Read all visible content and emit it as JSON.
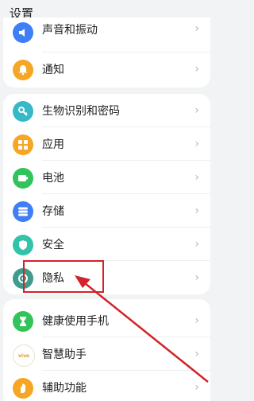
{
  "header": {
    "title": "设置"
  },
  "group1": [
    {
      "label": "声音和振动",
      "icon": "speaker-icon",
      "color": "#3f7ef5"
    },
    {
      "label": "通知",
      "icon": "bell-icon",
      "color": "#f5a623"
    }
  ],
  "group2": [
    {
      "label": "生物识别和密码",
      "icon": "key-icon",
      "color": "#35b8c8"
    },
    {
      "label": "应用",
      "icon": "apps-grid-icon",
      "color": "#f5a623"
    },
    {
      "label": "电池",
      "icon": "battery-icon",
      "color": "#32c35a"
    },
    {
      "label": "存储",
      "icon": "storage-icon",
      "color": "#3f7ef5"
    },
    {
      "label": "安全",
      "icon": "shield-icon",
      "color": "#32c3a8"
    },
    {
      "label": "隐私",
      "icon": "privacy-icon",
      "color": "#3f9c8c"
    }
  ],
  "group3": [
    {
      "label": "健康使用手机",
      "icon": "hourglass-icon",
      "color": "#32c35a"
    },
    {
      "label": "智慧助手",
      "icon": "vivo-icon",
      "color": "#ffffff",
      "icon_text": "vivo"
    },
    {
      "label": "辅助功能",
      "icon": "hand-icon",
      "color": "#f5a623"
    }
  ],
  "annotation": {
    "highlight_color": "#d2232a",
    "highlighted_item": "隐私"
  }
}
